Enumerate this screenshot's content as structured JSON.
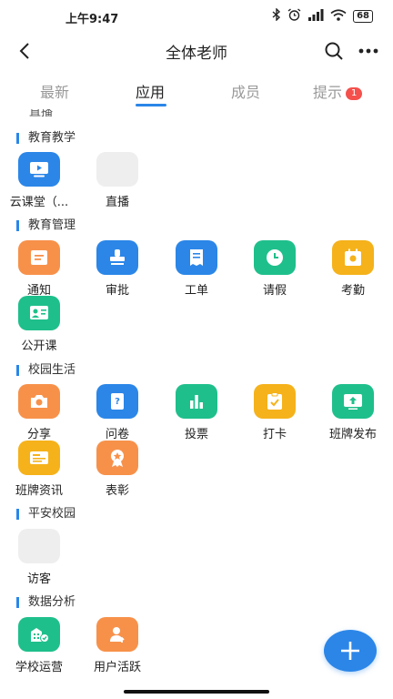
{
  "status_bar": {
    "time": "上午9:47",
    "battery": "68"
  },
  "nav": {
    "title": "全体老师"
  },
  "tabs": [
    {
      "label": "最新"
    },
    {
      "label": "应用"
    },
    {
      "label": "成员"
    },
    {
      "label": "提示",
      "badge": "1"
    }
  ],
  "partial_label": "直播",
  "sections": [
    {
      "title": "教育教学",
      "apps": [
        {
          "label": "云课堂（...",
          "icon": "play-screen-icon",
          "color": "#2b86e8"
        },
        {
          "label": "直播",
          "icon": "placeholder-icon",
          "color": "#eeeeee"
        }
      ]
    },
    {
      "title": "教育管理",
      "apps": [
        {
          "label": "通知",
          "icon": "notice-icon",
          "color": "#f7914a"
        },
        {
          "label": "审批",
          "icon": "stamp-icon",
          "color": "#2b86e8"
        },
        {
          "label": "工单",
          "icon": "ticket-icon",
          "color": "#2b86e8"
        },
        {
          "label": "请假",
          "icon": "clock-icon",
          "color": "#1fbf8b"
        },
        {
          "label": "考勤",
          "icon": "attendance-icon",
          "color": "#f5b21b"
        },
        {
          "label": "公开课",
          "icon": "open-class-icon",
          "color": "#1fbf8b"
        }
      ]
    },
    {
      "title": "校园生活",
      "apps": [
        {
          "label": "分享",
          "icon": "camera-icon",
          "color": "#f7914a"
        },
        {
          "label": "问卷",
          "icon": "questionnaire-icon",
          "color": "#2b86e8"
        },
        {
          "label": "投票",
          "icon": "bar-chart-icon",
          "color": "#1fbf8b"
        },
        {
          "label": "打卡",
          "icon": "checkin-icon",
          "color": "#f5b21b"
        },
        {
          "label": "班牌发布",
          "icon": "board-upload-icon",
          "color": "#1fbf8b"
        },
        {
          "label": "班牌资讯",
          "icon": "board-news-icon",
          "color": "#f5b21b"
        },
        {
          "label": "表彰",
          "icon": "award-icon",
          "color": "#f7914a"
        }
      ]
    },
    {
      "title": "平安校园",
      "apps": [
        {
          "label": "访客",
          "icon": "placeholder-icon",
          "color": "#eeeeee"
        }
      ]
    },
    {
      "title": "数据分析",
      "apps": [
        {
          "label": "学校运营",
          "icon": "school-building-icon",
          "color": "#1fbf8b"
        },
        {
          "label": "用户活跃",
          "icon": "user-active-icon",
          "color": "#f7914a"
        }
      ]
    }
  ],
  "colors": {
    "accent": "#2b86e8",
    "badge": "#f4504c"
  }
}
